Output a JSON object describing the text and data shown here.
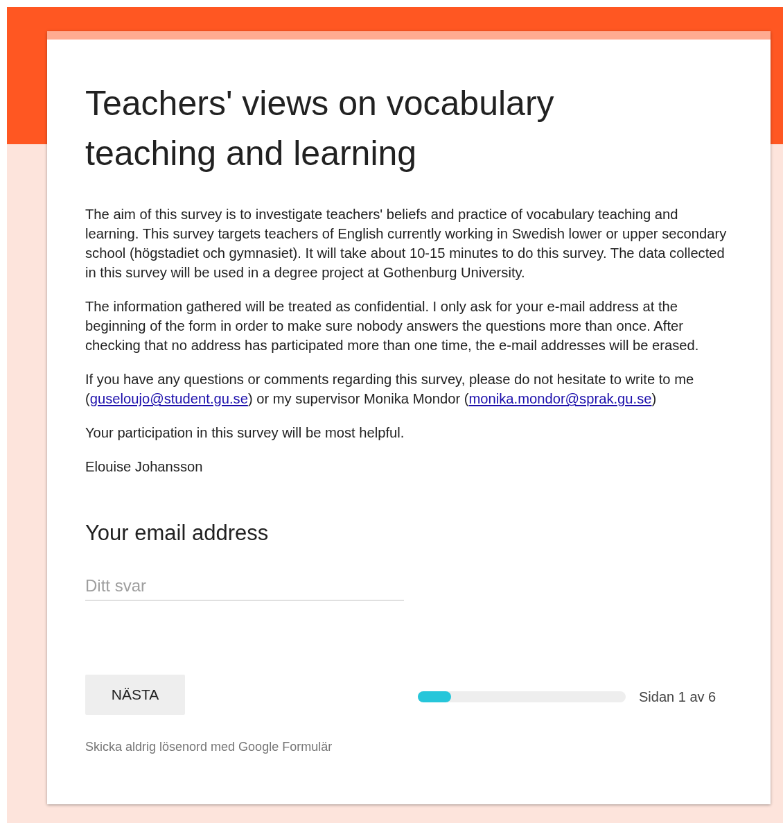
{
  "header": {
    "title": "Teachers' views on vocabulary teaching and learning"
  },
  "description": [
    {
      "parts": [
        {
          "kind": "text",
          "text": "The aim of this survey is to investigate teachers' beliefs and practice of vocabulary teaching and learning. This survey targets teachers of English currently working in Swedish lower or upper secondary school (högstadiet och gymnasiet). It will take about 10-15 minutes to do this survey. The data collected in this survey will be used in a degree project at Gothenburg University."
        }
      ]
    },
    {
      "parts": [
        {
          "kind": "text",
          "text": "The information gathered will be treated as confidential. I only ask for your e-mail address at the beginning of the form in order to make sure nobody answers the questions more than once. After checking that no address has participated more than one time, the e-mail addresses will be erased."
        }
      ]
    },
    {
      "parts": [
        {
          "kind": "text",
          "text": "If you have any questions or comments regarding this survey, please do not hesitate to write to me ("
        },
        {
          "kind": "link",
          "text": "guseloujo@student.gu.se"
        },
        {
          "kind": "text",
          "text": ") or my supervisor Monika Mondor ("
        },
        {
          "kind": "link",
          "text": "monika.mondor@sprak.gu.se"
        },
        {
          "kind": "text",
          "text": ")"
        }
      ]
    },
    {
      "parts": [
        {
          "kind": "text",
          "text": "Your participation in this survey will be most helpful."
        }
      ]
    },
    {
      "parts": [
        {
          "kind": "text",
          "text": "Elouise Johansson"
        }
      ]
    }
  ],
  "question": {
    "title": "Your email address",
    "placeholder": "Ditt svar"
  },
  "next_button": "NÄSTA",
  "progress": {
    "level": 0.16,
    "label": "Sidan 1 av 6"
  },
  "footer_note": "Skicka aldrig lösenord med Google Formulär"
}
